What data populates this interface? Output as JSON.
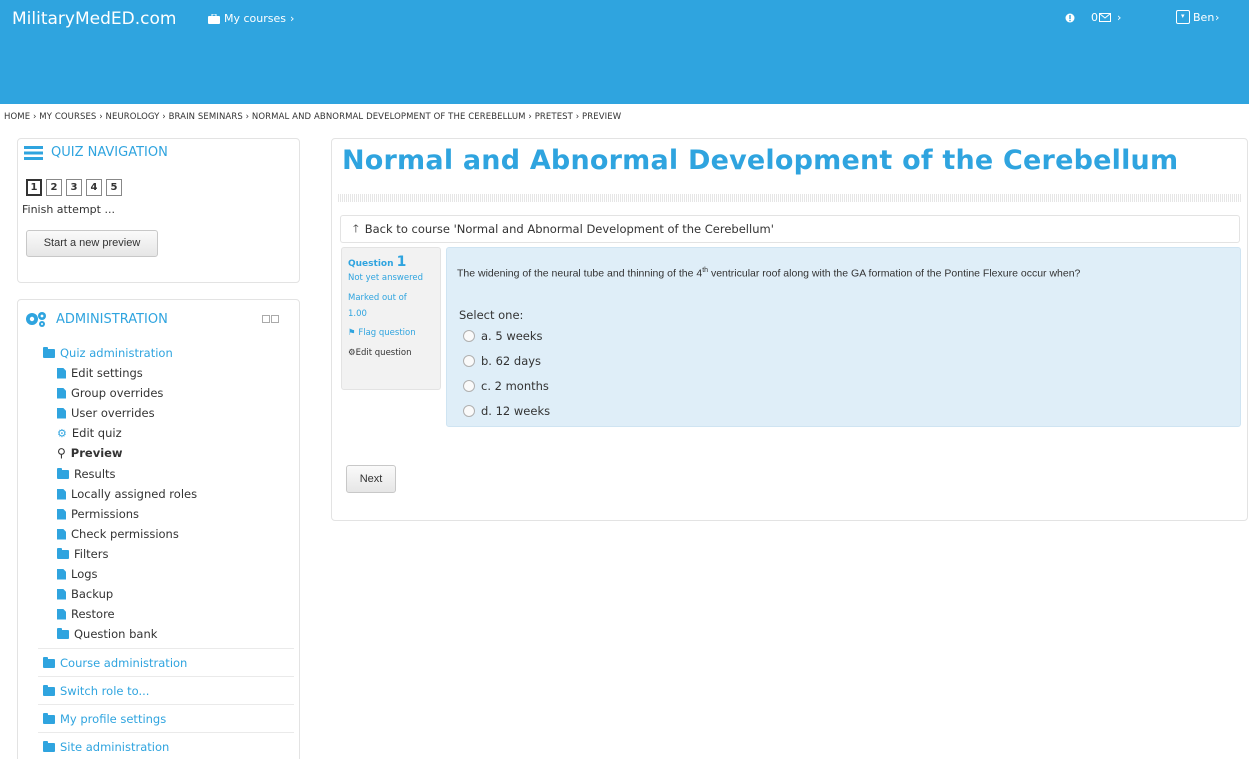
{
  "header": {
    "brand": "MilitaryMedED.com",
    "my_courses": "My courses",
    "notif_count": "0",
    "user": "Ben",
    "brand_color": "#2fa4df"
  },
  "breadcrumb": "HOME › MY COURSES › NEUROLOGY › BRAIN SEMINARS › NORMAL AND ABNORMAL DEVELOPMENT OF THE CEREBELLUM › PRETEST › PREVIEW",
  "quiz_nav": {
    "title": "QUIZ NAVIGATION",
    "questions": [
      "1",
      "2",
      "3",
      "4",
      "5"
    ],
    "finish": "Finish attempt ...",
    "start_preview": "Start a new preview"
  },
  "admin": {
    "title": "ADMINISTRATION",
    "quiz_admin": "Quiz administration",
    "items": [
      {
        "label": "Edit settings",
        "icon": "doc-icon"
      },
      {
        "label": "Group overrides",
        "icon": "doc-icon"
      },
      {
        "label": "User overrides",
        "icon": "doc-icon"
      },
      {
        "label": "Edit quiz",
        "icon": "gear-icon"
      },
      {
        "label": "Preview",
        "icon": "search-icon"
      },
      {
        "label": "Results",
        "icon": "folder-icon"
      },
      {
        "label": "Locally assigned roles",
        "icon": "doc-icon"
      },
      {
        "label": "Permissions",
        "icon": "doc-icon"
      },
      {
        "label": "Check permissions",
        "icon": "doc-icon"
      },
      {
        "label": "Filters",
        "icon": "folder-icon"
      },
      {
        "label": "Logs",
        "icon": "doc-icon"
      },
      {
        "label": "Backup",
        "icon": "doc-icon"
      },
      {
        "label": "Restore",
        "icon": "doc-icon"
      },
      {
        "label": "Question bank",
        "icon": "folder-icon"
      }
    ],
    "sections": [
      "Course administration",
      "Switch role to...",
      "My profile settings",
      "Site administration"
    ]
  },
  "main": {
    "title": "Normal and Abnormal Development of the Cerebellum",
    "back": "Back to course 'Normal and Abnormal Development of the Cerebellum'",
    "question": {
      "label": "Question",
      "number": "1",
      "status": "Not yet answered",
      "marked": "Marked out of",
      "marks": "1.00",
      "flag": "Flag question",
      "edit": "Edit question",
      "text_before": "The widening of the neural tube and thinning of the 4",
      "text_sup": "th",
      "text_after": " ventricular roof along with the GA formation of the Pontine Flexure occur when?",
      "select_one": "Select one:",
      "options": [
        "a. 5 weeks",
        "b. 62 days",
        "c. 2 months",
        "d. 12 weeks"
      ]
    },
    "next": "Next"
  }
}
